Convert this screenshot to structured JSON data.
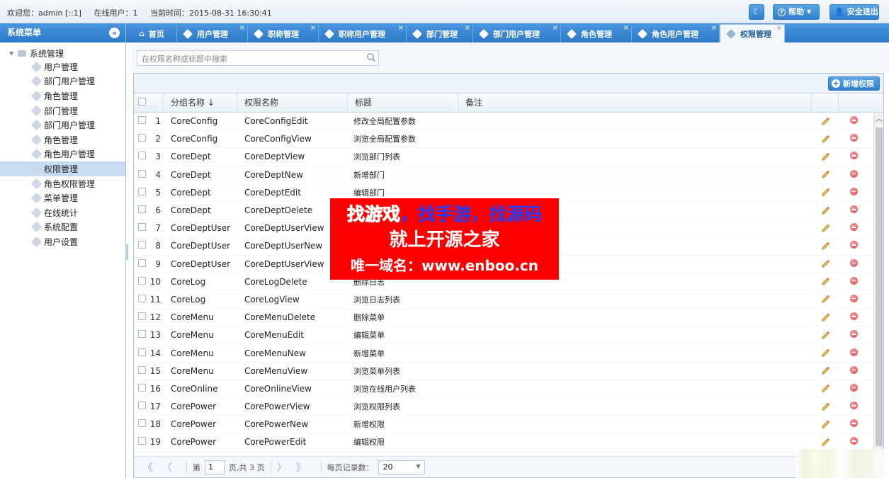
{
  "topbar": {
    "welcome": "欢迎您：admin [::1]",
    "online": "在线用户：1",
    "time": "当前时间：2015-08-31 16:30:41",
    "help_label": "帮助",
    "logout_label": "安全退出"
  },
  "sidebar": {
    "title": "系统菜单",
    "root_label": "系统管理",
    "items": [
      {
        "label": "用户管理"
      },
      {
        "label": "部门用户管理"
      },
      {
        "label": "角色管理"
      },
      {
        "label": "部门管理"
      },
      {
        "label": "部门用户管理"
      },
      {
        "label": "角色管理"
      },
      {
        "label": "角色用户管理"
      },
      {
        "label": "权限管理"
      },
      {
        "label": "角色权限管理"
      },
      {
        "label": "菜单管理"
      },
      {
        "label": "在线统计"
      },
      {
        "label": "系统配置"
      },
      {
        "label": "用户设置"
      }
    ],
    "selected_index": 7
  },
  "tabs": [
    {
      "label": "首页"
    },
    {
      "label": "用户管理"
    },
    {
      "label": "职称管理"
    },
    {
      "label": "职称用户管理"
    },
    {
      "label": "部门管理"
    },
    {
      "label": "部门用户管理"
    },
    {
      "label": "角色管理"
    },
    {
      "label": "角色用户管理"
    },
    {
      "label": "权限管理"
    }
  ],
  "active_tab": 8,
  "search": {
    "placeholder": "在权限名称或标题中搜索"
  },
  "toolbar": {
    "add_label": "新增权限"
  },
  "grid": {
    "columns": {
      "group": "分组名称 ↓",
      "name": "权限名称",
      "title": "标题",
      "note": "备注"
    },
    "rows": [
      {
        "num": "1",
        "group": "CoreConfig",
        "name": "CoreConfigEdit",
        "title": "修改全局配置参数"
      },
      {
        "num": "2",
        "group": "CoreConfig",
        "name": "CoreConfigView",
        "title": "浏览全局配置参数"
      },
      {
        "num": "3",
        "group": "CoreDept",
        "name": "CoreDeptView",
        "title": "浏览部门列表"
      },
      {
        "num": "4",
        "group": "CoreDept",
        "name": "CoreDeptNew",
        "title": "新增部门"
      },
      {
        "num": "5",
        "group": "CoreDept",
        "name": "CoreDeptEdit",
        "title": "编辑部门"
      },
      {
        "num": "6",
        "group": "CoreDept",
        "name": "CoreDeptDelete",
        "title": ""
      },
      {
        "num": "7",
        "group": "CoreDeptUser",
        "name": "CoreDeptUserView",
        "title": ""
      },
      {
        "num": "8",
        "group": "CoreDeptUser",
        "name": "CoreDeptUserNew",
        "title": ""
      },
      {
        "num": "9",
        "group": "CoreDeptUser",
        "name": "CoreDeptUserView",
        "title": ""
      },
      {
        "num": "10",
        "group": "CoreLog",
        "name": "CoreLogDelete",
        "title": "删除日志"
      },
      {
        "num": "11",
        "group": "CoreLog",
        "name": "CoreLogView",
        "title": "浏览日志列表"
      },
      {
        "num": "12",
        "group": "CoreMenu",
        "name": "CoreMenuDelete",
        "title": "删除菜单"
      },
      {
        "num": "13",
        "group": "CoreMenu",
        "name": "CoreMenuEdit",
        "title": "编辑菜单"
      },
      {
        "num": "14",
        "group": "CoreMenu",
        "name": "CoreMenuNew",
        "title": "新增菜单"
      },
      {
        "num": "15",
        "group": "CoreMenu",
        "name": "CoreMenuView",
        "title": "浏览菜单列表"
      },
      {
        "num": "16",
        "group": "CoreOnline",
        "name": "CoreOnlineView",
        "title": "浏览在线用户列表"
      },
      {
        "num": "17",
        "group": "CorePower",
        "name": "CorePowerView",
        "title": "浏览权限列表"
      },
      {
        "num": "18",
        "group": "CorePower",
        "name": "CorePowerNew",
        "title": "新增权限"
      },
      {
        "num": "19",
        "group": "CorePower",
        "name": "CorePowerEdit",
        "title": "编辑权限"
      }
    ]
  },
  "pager": {
    "page_prefix": "第",
    "page_value": "1",
    "page_suffix": "页,共 3 页",
    "per_page_label": "每页记录数：",
    "per_page_value": "20"
  },
  "ad": {
    "line1_a": "找游戏",
    "line1_b": "，找手游，找源码",
    "line2": "就上开源之家",
    "line3": "唯一域名：www.enboo.cn"
  }
}
